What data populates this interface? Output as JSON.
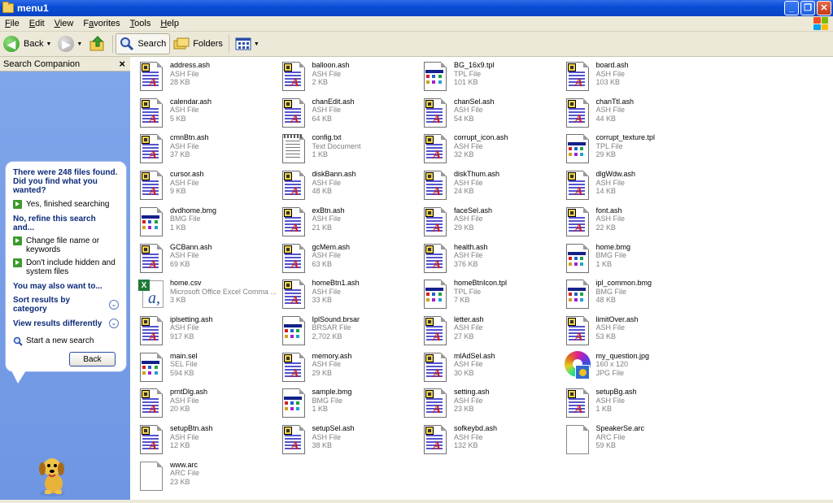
{
  "window": {
    "title": "menu1"
  },
  "menu": [
    "File",
    "Edit",
    "View",
    "Favorites",
    "Tools",
    "Help"
  ],
  "menu_underline": [
    "F",
    "E",
    "V",
    "a",
    "T",
    "H"
  ],
  "toolbar": {
    "back_label": "Back",
    "search_label": "Search",
    "folders_label": "Folders"
  },
  "search_companion": {
    "title": "Search Companion",
    "found_message": "There were 248 files found. Did you find what you wanted?",
    "yes_option": "Yes, finished searching",
    "refine_header": "No, refine this search and...",
    "refine_change": "Change file name or keywords",
    "refine_hidden": "Don't include hidden and system files",
    "also_header": "You may also want to...",
    "sort_label": "Sort results by category",
    "view_label": "View results differently",
    "new_search": "Start a new search",
    "back_button": "Back"
  },
  "files": [
    {
      "name": "address.ash",
      "type": "ASH File",
      "size": "28 KB",
      "icon": "ash"
    },
    {
      "name": "balloon.ash",
      "type": "ASH File",
      "size": "2 KB",
      "icon": "ash"
    },
    {
      "name": "BG_16x9.tpl",
      "type": "TPL File",
      "size": "101 KB",
      "icon": "tpl"
    },
    {
      "name": "board.ash",
      "type": "ASH File",
      "size": "103 KB",
      "icon": "ash"
    },
    {
      "name": "calendar.ash",
      "type": "ASH File",
      "size": "5 KB",
      "icon": "ash"
    },
    {
      "name": "chanEdit.ash",
      "type": "ASH File",
      "size": "64 KB",
      "icon": "ash"
    },
    {
      "name": "chanSel.ash",
      "type": "ASH File",
      "size": "54 KB",
      "icon": "ash"
    },
    {
      "name": "chanTtl.ash",
      "type": "ASH File",
      "size": "44 KB",
      "icon": "ash"
    },
    {
      "name": "cmnBtn.ash",
      "type": "ASH File",
      "size": "37 KB",
      "icon": "ash"
    },
    {
      "name": "config.txt",
      "type": "Text Document",
      "size": "1 KB",
      "icon": "txt"
    },
    {
      "name": "corrupt_icon.ash",
      "type": "ASH File",
      "size": "32 KB",
      "icon": "ash"
    },
    {
      "name": "corrupt_texture.tpl",
      "type": "TPL File",
      "size": "29 KB",
      "icon": "tpl"
    },
    {
      "name": "cursor.ash",
      "type": "ASH File",
      "size": "9 KB",
      "icon": "ash"
    },
    {
      "name": "diskBann.ash",
      "type": "ASH File",
      "size": "48 KB",
      "icon": "ash"
    },
    {
      "name": "diskThum.ash",
      "type": "ASH File",
      "size": "24 KB",
      "icon": "ash"
    },
    {
      "name": "dlgWdw.ash",
      "type": "ASH File",
      "size": "14 KB",
      "icon": "ash"
    },
    {
      "name": "dvdhome.bmg",
      "type": "BMG File",
      "size": "1 KB",
      "icon": "tpl"
    },
    {
      "name": "exBtn.ash",
      "type": "ASH File",
      "size": "21 KB",
      "icon": "ash"
    },
    {
      "name": "faceSel.ash",
      "type": "ASH File",
      "size": "29 KB",
      "icon": "ash"
    },
    {
      "name": "font.ash",
      "type": "ASH File",
      "size": "22 KB",
      "icon": "ash"
    },
    {
      "name": "GCBann.ash",
      "type": "ASH File",
      "size": "69 KB",
      "icon": "ash"
    },
    {
      "name": "gcMem.ash",
      "type": "ASH File",
      "size": "63 KB",
      "icon": "ash"
    },
    {
      "name": "health.ash",
      "type": "ASH File",
      "size": "376 KB",
      "icon": "ash"
    },
    {
      "name": "home.bmg",
      "type": "BMG File",
      "size": "1 KB",
      "icon": "tpl"
    },
    {
      "name": "home.csv",
      "type": "Microsoft Office Excel Comma ...",
      "size": "3 KB",
      "icon": "csv"
    },
    {
      "name": "homeBtn1.ash",
      "type": "ASH File",
      "size": "33 KB",
      "icon": "ash"
    },
    {
      "name": "homeBtnIcon.tpl",
      "type": "TPL File",
      "size": "7 KB",
      "icon": "tpl"
    },
    {
      "name": "ipl_common.bmg",
      "type": "BMG File",
      "size": "48 KB",
      "icon": "tpl"
    },
    {
      "name": "iplsetting.ash",
      "type": "ASH File",
      "size": "917 KB",
      "icon": "ash"
    },
    {
      "name": "IplSound.brsar",
      "type": "BRSAR File",
      "size": "2,702 KB",
      "icon": "tpl"
    },
    {
      "name": "letter.ash",
      "type": "ASH File",
      "size": "27 KB",
      "icon": "ash"
    },
    {
      "name": "limitOver.ash",
      "type": "ASH File",
      "size": "53 KB",
      "icon": "ash"
    },
    {
      "name": "main.sel",
      "type": "SEL File",
      "size": "594 KB",
      "icon": "tpl"
    },
    {
      "name": "memory.ash",
      "type": "ASH File",
      "size": "29 KB",
      "icon": "ash"
    },
    {
      "name": "mlAdSel.ash",
      "type": "ASH File",
      "size": "30 KB",
      "icon": "ash"
    },
    {
      "name": "my_question.jpg",
      "type": "160 x 120",
      "size": "JPG File",
      "icon": "jpg"
    },
    {
      "name": "prntDlg.ash",
      "type": "ASH File",
      "size": "20 KB",
      "icon": "ash"
    },
    {
      "name": "sample.bmg",
      "type": "BMG File",
      "size": "1 KB",
      "icon": "tpl"
    },
    {
      "name": "setting.ash",
      "type": "ASH File",
      "size": "23 KB",
      "icon": "ash"
    },
    {
      "name": "setupBg.ash",
      "type": "ASH File",
      "size": "1 KB",
      "icon": "ash"
    },
    {
      "name": "setupBtn.ash",
      "type": "ASH File",
      "size": "12 KB",
      "icon": "ash"
    },
    {
      "name": "setupSel.ash",
      "type": "ASH File",
      "size": "38 KB",
      "icon": "ash"
    },
    {
      "name": "sofkeybd.ash",
      "type": "ASH File",
      "size": "132 KB",
      "icon": "ash"
    },
    {
      "name": "SpeakerSe.arc",
      "type": "ARC File",
      "size": "59 KB",
      "icon": "arc"
    },
    {
      "name": "www.arc",
      "type": "ARC File",
      "size": "23 KB",
      "icon": "arc"
    }
  ],
  "colors": {
    "title_bar": "#0a4fd6",
    "pane_blue": "#7fa5ea",
    "ash_lines": "#5353cf",
    "ash_letter": "#d11a1a"
  }
}
